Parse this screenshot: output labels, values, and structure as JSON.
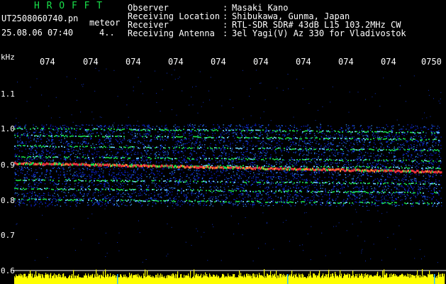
{
  "header": {
    "app_title": "H R O F F T",
    "filename": "UT2508060740.pn",
    "file_suffix": "meteor",
    "datetime": "25.08.06 07:40",
    "count": "4.."
  },
  "info": [
    {
      "label": "Observer",
      "colon": ":",
      "value": "Masaki Kano"
    },
    {
      "label": "Receiving Location",
      "colon": ":",
      "value": "Shibukawa, Gunma, Japan"
    },
    {
      "label": "Receiver",
      "colon": ":",
      "value": "RTL-SDR SDR# 43dB L15 103.2MHz CW"
    },
    {
      "label": "Receiving Antenna",
      "colon": ":",
      "value": "3el Yagi(V) Az 330 for Vladivostok"
    }
  ],
  "chart_data": {
    "type": "heatmap",
    "unit_label": "kHz",
    "time_ticks": [
      "074",
      "074",
      "074",
      "074",
      "074",
      "074",
      "074",
      "074",
      "074",
      "0750"
    ],
    "y_ticks": [
      "1.1",
      "1.0",
      "0.9",
      "0.8",
      "0.7",
      "0.6"
    ],
    "ylim": [
      0.6,
      1.12
    ],
    "signal_lines_khz": [
      1.0,
      0.98,
      0.95,
      0.92,
      0.9,
      0.855,
      0.83,
      0.8
    ],
    "main_signal_khz": [
      0.9,
      0.875
    ],
    "colors": {
      "background": "#000000",
      "noise": "#0a1fd0",
      "signal": "#19e04a",
      "peak": "#e8303a",
      "level_bar": "#ffff00",
      "title_green": "#19e04a"
    }
  }
}
